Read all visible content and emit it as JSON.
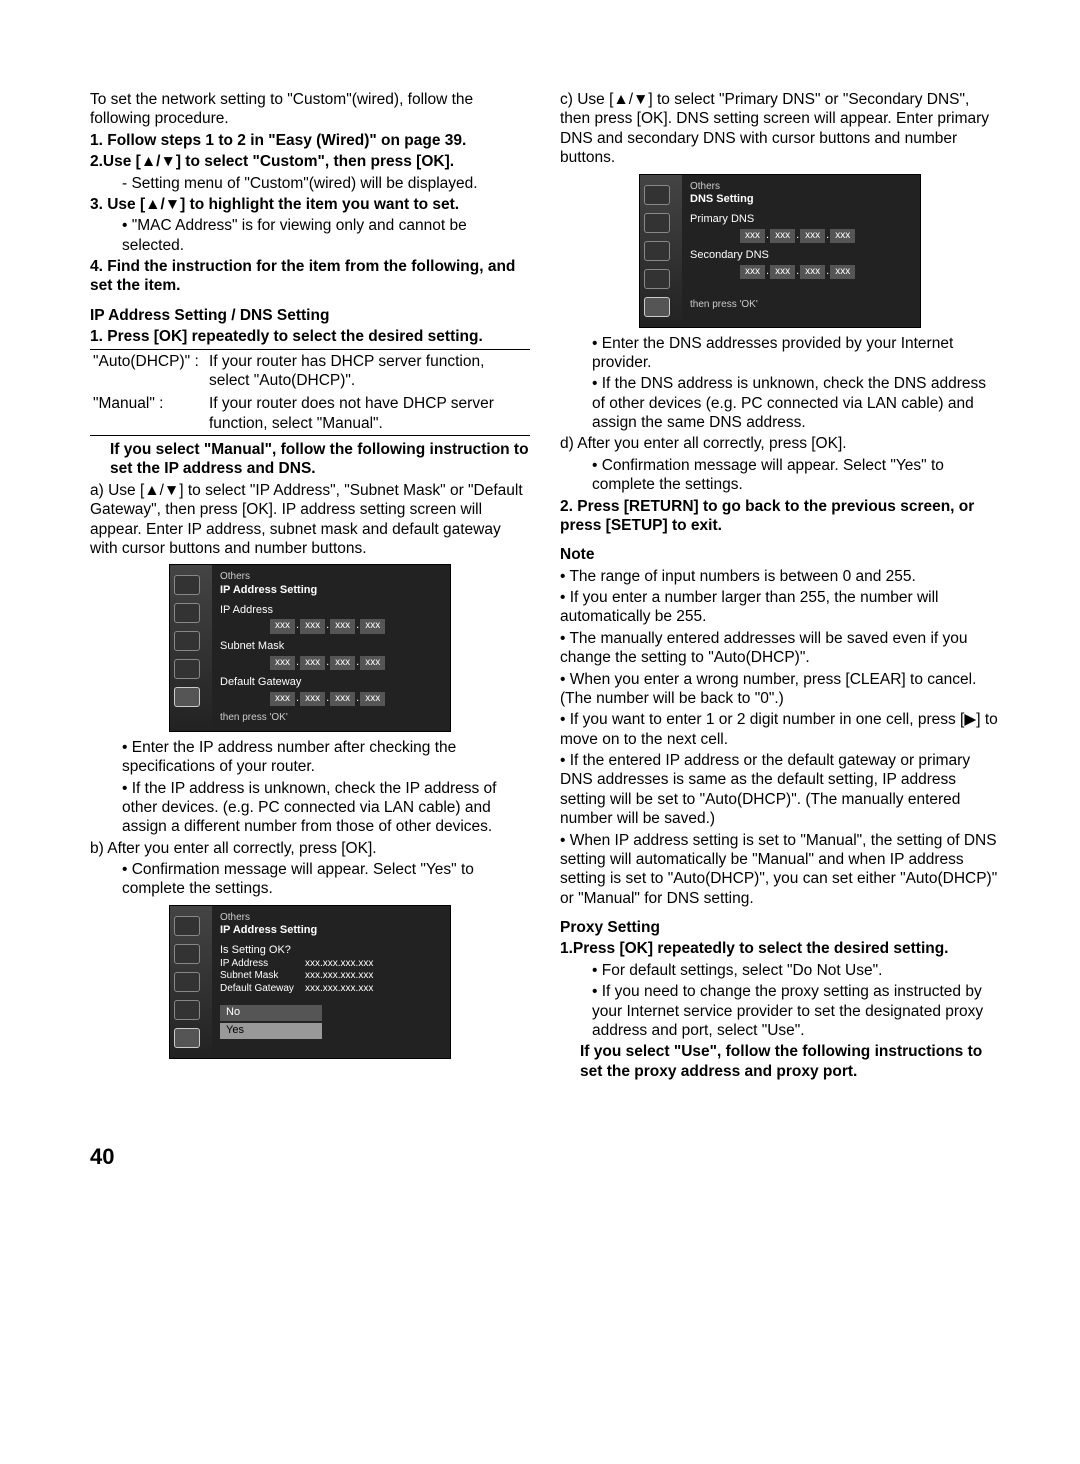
{
  "intro": "To set the network setting to \"Custom\"(wired), follow the following procedure.",
  "steps": [
    {
      "t": "1. Follow steps 1 to 2 in \"Easy (Wired)\" on page 39.",
      "b": true
    },
    {
      "t": "2.Use [▲/▼] to select \"Custom\", then press [OK].",
      "b": true
    },
    {
      "t": "- Setting menu of \"Custom\"(wired) will be displayed.",
      "indent": "step-sub"
    },
    {
      "t": "3. Use [▲/▼] to highlight the item you want to set.",
      "b": true
    },
    {
      "t": "• \"MAC Address\" is for viewing only and cannot be selected.",
      "indent": "step-sub"
    },
    {
      "t": "4. Find the instruction for the item from the following, and set the item.",
      "b": true
    }
  ],
  "sectionA": {
    "h": "IP Address Setting / DNS Setting",
    "s1": "1. Press [OK] repeatedly to select the desired setting.",
    "table": [
      {
        "k": "\"Auto(DHCP)\" :",
        "v": "If your router has DHCP server function, select \"Auto(DHCP)\"."
      },
      {
        "k": "\"Manual\" :",
        "v": "If your router does not have DHCP server function, select \"Manual\"."
      }
    ],
    "manualHead": "If you select \"Manual\", follow the following instruction to set the IP address and DNS.",
    "a": "a) Use [▲/▼] to select \"IP Address\", \"Subnet Mask\" or \"Default Gateway\", then press [OK]. IP address setting screen will appear. Enter IP address, subnet mask and default gateway with cursor buttons and number buttons.",
    "aBullets": [
      "Enter the IP address number after checking the specifications of your router.",
      "If the IP address is unknown, check the IP address of other devices. (e.g. PC connected via LAN cable) and assign a different number from those of other devices."
    ],
    "b": "b) After you enter all correctly, press [OK].",
    "bBullet": "Confirmation message will appear. Select \"Yes\" to complete the settings."
  },
  "fig1": {
    "cat": "Others",
    "title": "IP Address Setting",
    "rows": [
      "IP Address",
      "Subnet Mask",
      "Default Gateway"
    ],
    "footer": "then press 'OK'",
    "oct": "xxx"
  },
  "fig2": {
    "cat": "Others",
    "title": "IP Address Setting",
    "q": "Is Setting OK?",
    "rows": [
      {
        "k": "IP Address",
        "v": "xxx.xxx.xxx.xxx"
      },
      {
        "k": "Subnet Mask",
        "v": "xxx.xxx.xxx.xxx"
      },
      {
        "k": "Default Gateway",
        "v": "xxx.xxx.xxx.xxx"
      }
    ],
    "no": "No",
    "yes": "Yes"
  },
  "col2": {
    "c": "c) Use [▲/▼] to select \"Primary DNS\" or \"Secondary DNS\", then press [OK]. DNS setting screen will appear. Enter primary DNS and secondary DNS with cursor buttons and number buttons.",
    "cBullets": [
      "Enter the DNS addresses provided by your Internet provider.",
      "If the DNS address is unknown, check the DNS address of other devices (e.g. PC connected via LAN cable) and assign the same DNS address."
    ],
    "d": "d) After you enter all correctly, press [OK].",
    "dBullet": "Confirmation message will appear. Select \"Yes\" to complete the settings.",
    "s2": "2. Press [RETURN] to go back to the previous screen, or press [SETUP] to exit.",
    "noteH": "Note",
    "notes": [
      "The range of input numbers is between 0 and 255.",
      "If you enter a number larger than 255, the number will automatically be 255.",
      "The manually entered addresses will be saved even if you change the setting to \"Auto(DHCP)\".",
      "When you enter a wrong number, press [CLEAR] to cancel. (The number will be back to \"0\".)",
      "If you want to enter 1 or 2 digit number in one cell, press [▶] to move on to the next cell.",
      "If the entered IP address or the default gateway or primary DNS addresses is same as the default setting, IP address setting will be set to \"Auto(DHCP)\". (The manually entered number will be saved.)",
      "When IP address setting is set to \"Manual\", the setting of DNS setting will automatically be \"Manual\" and when IP address setting is set to \"Auto(DHCP)\", you can set either \"Auto(DHCP)\" or \"Manual\" for DNS setting."
    ],
    "proxyH": "Proxy Setting",
    "proxyS1": "1.Press [OK] repeatedly to select the desired setting.",
    "proxyBullets": [
      "For default settings, select \"Do Not Use\".",
      "If you need to change the proxy setting as instructed by your Internet service provider to set the designated proxy address and port, select \"Use\"."
    ],
    "proxyUse": "If you select \"Use\", follow the following instructions to set the proxy address and proxy port."
  },
  "fig3": {
    "cat": "Others",
    "title": "DNS Setting",
    "rows": [
      "Primary DNS",
      "Secondary DNS"
    ],
    "footer": "then press 'OK'",
    "oct": "xxx"
  },
  "pageNum": "40"
}
